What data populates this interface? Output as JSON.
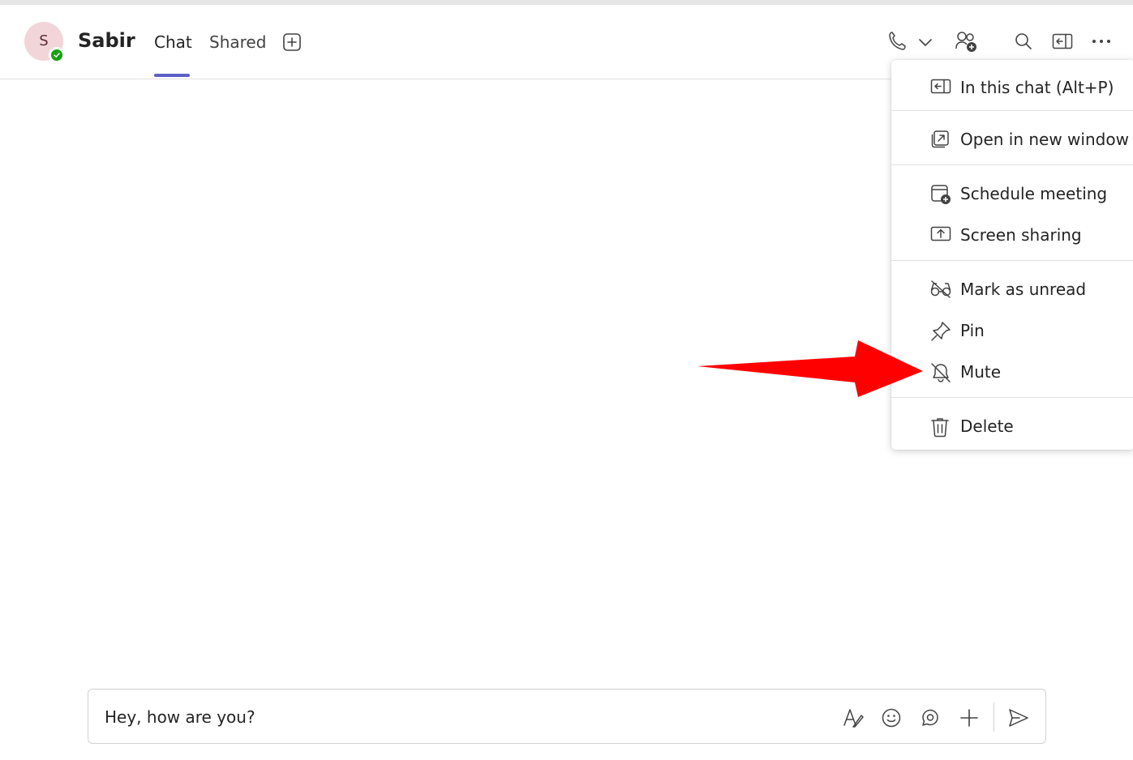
{
  "header": {
    "avatar_initial": "S",
    "contact_name": "Sabir",
    "tabs": [
      {
        "label": "Chat",
        "active": true
      },
      {
        "label": "Shared",
        "active": false
      }
    ]
  },
  "toolbar": {
    "icons": [
      "call-icon",
      "chevron-down-icon",
      "add-people-icon",
      "search-icon",
      "popout-panel-icon",
      "more-options-icon"
    ]
  },
  "menu": {
    "items": [
      {
        "label": "In this chat (Alt+P)",
        "icon": "panel-icon"
      },
      {
        "label": "Open in new window",
        "icon": "open-new-window-icon"
      },
      {
        "label": "Schedule meeting",
        "icon": "calendar-add-icon"
      },
      {
        "label": "Screen sharing",
        "icon": "screen-share-icon"
      },
      {
        "label": "Mark as unread",
        "icon": "glasses-off-icon"
      },
      {
        "label": "Pin",
        "icon": "pin-icon"
      },
      {
        "label": "Mute",
        "icon": "bell-off-icon"
      },
      {
        "label": "Delete",
        "icon": "trash-icon"
      }
    ]
  },
  "composer": {
    "value": "Hey, how are you?",
    "icons": [
      "format-icon",
      "emoji-icon",
      "loop-icon",
      "attach-plus-icon",
      "send-icon"
    ]
  },
  "colors": {
    "accent": "#5b5fc7",
    "presence": "#13a10e",
    "annotation_arrow": "#ff0000"
  }
}
